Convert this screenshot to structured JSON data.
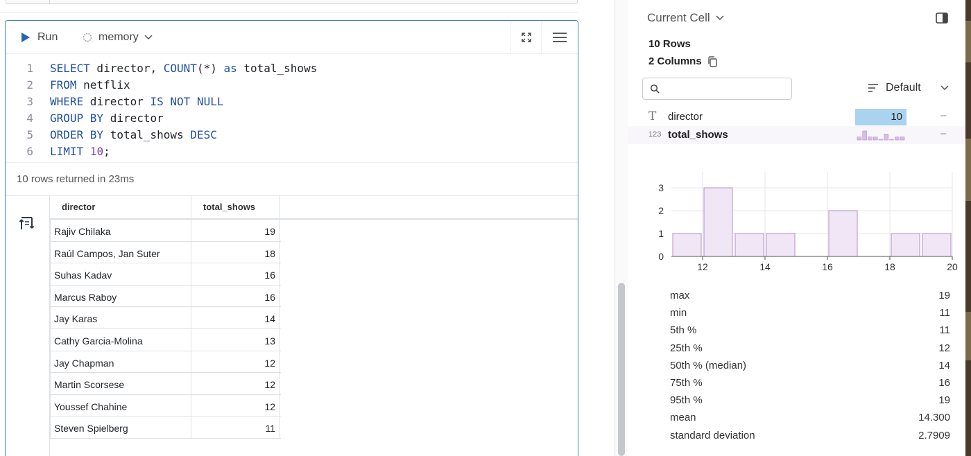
{
  "toolbar": {
    "run_label": "Run",
    "connection_label": "memory"
  },
  "editor": {
    "lines": [
      {
        "n": "1",
        "tokens": [
          [
            "kw",
            "SELECT"
          ],
          [
            "op",
            " director, "
          ],
          [
            "kw",
            "COUNT"
          ],
          [
            "op",
            "(*) "
          ],
          [
            "kw",
            "as"
          ],
          [
            "op",
            " total_shows"
          ]
        ]
      },
      {
        "n": "2",
        "tokens": [
          [
            "kw",
            "FROM"
          ],
          [
            "op",
            " netflix"
          ]
        ]
      },
      {
        "n": "3",
        "tokens": [
          [
            "kw",
            "WHERE"
          ],
          [
            "op",
            " director "
          ],
          [
            "kw",
            "IS NOT NULL"
          ]
        ]
      },
      {
        "n": "4",
        "tokens": [
          [
            "kw",
            "GROUP BY"
          ],
          [
            "op",
            " director"
          ]
        ]
      },
      {
        "n": "5",
        "tokens": [
          [
            "kw",
            "ORDER BY"
          ],
          [
            "op",
            " total_shows "
          ],
          [
            "kw",
            "DESC"
          ]
        ]
      },
      {
        "n": "6",
        "tokens": [
          [
            "kw",
            "LIMIT"
          ],
          [
            "op",
            " "
          ],
          [
            "num",
            "10"
          ],
          [
            "op",
            ";"
          ]
        ]
      }
    ]
  },
  "status": "10 rows returned in 23ms",
  "table": {
    "columns": [
      "director",
      "total_shows"
    ],
    "rows": [
      [
        "Rajiv Chilaka",
        "19"
      ],
      [
        "Raúl Campos, Jan Suter",
        "18"
      ],
      [
        "Suhas Kadav",
        "16"
      ],
      [
        "Marcus Raboy",
        "16"
      ],
      [
        "Jay Karas",
        "14"
      ],
      [
        "Cathy Garcia-Molina",
        "13"
      ],
      [
        "Jay Chapman",
        "12"
      ],
      [
        "Martin Scorsese",
        "12"
      ],
      [
        "Youssef Chahine",
        "12"
      ],
      [
        "Steven Spielberg",
        "11"
      ]
    ]
  },
  "panel": {
    "title": "Current Cell",
    "rows_label": "10 Rows",
    "columns_label": "2 Columns",
    "search_placeholder": "",
    "sort_label": "Default",
    "columns": [
      {
        "type_icon": "T",
        "name": "director",
        "summary": "10",
        "dash": "–"
      },
      {
        "type_icon": "123",
        "name": "total_shows",
        "summary": "",
        "dash": "–"
      }
    ],
    "histogram": {
      "y_ticks": [
        "3",
        "2",
        "1",
        "0"
      ],
      "x_ticks": [
        "12",
        "14",
        "16",
        "18",
        "20"
      ],
      "bins": [
        {
          "from": 11,
          "to": 12,
          "count": 1
        },
        {
          "from": 12,
          "to": 13,
          "count": 3
        },
        {
          "from": 13,
          "to": 14,
          "count": 1
        },
        {
          "from": 14,
          "to": 15,
          "count": 1
        },
        {
          "from": 15,
          "to": 16,
          "count": 0
        },
        {
          "from": 16,
          "to": 17,
          "count": 2
        },
        {
          "from": 17,
          "to": 18,
          "count": 0
        },
        {
          "from": 18,
          "to": 19,
          "count": 1
        },
        {
          "from": 19,
          "to": 20,
          "count": 1
        }
      ],
      "x_range": [
        11,
        20
      ],
      "y_max": 3,
      "bar_color": "#f1e6f6",
      "bar_stroke": "#b58fc8"
    },
    "stats": [
      {
        "k": "max",
        "v": "19"
      },
      {
        "k": "min",
        "v": "11"
      },
      {
        "k": "5th %",
        "v": "11"
      },
      {
        "k": "25th %",
        "v": "12"
      },
      {
        "k": "50th % (median)",
        "v": "14"
      },
      {
        "k": "75th %",
        "v": "16"
      },
      {
        "k": "95th %",
        "v": "19"
      },
      {
        "k": "mean",
        "v": "14.300"
      },
      {
        "k": "standard deviation",
        "v": "2.7909"
      }
    ]
  },
  "colors": {
    "accent": "#2563b8",
    "keyword": "#2050a8",
    "number": "#7a3dab",
    "cell_border": "#3b82c4",
    "highlight": "#a9d3ee"
  }
}
